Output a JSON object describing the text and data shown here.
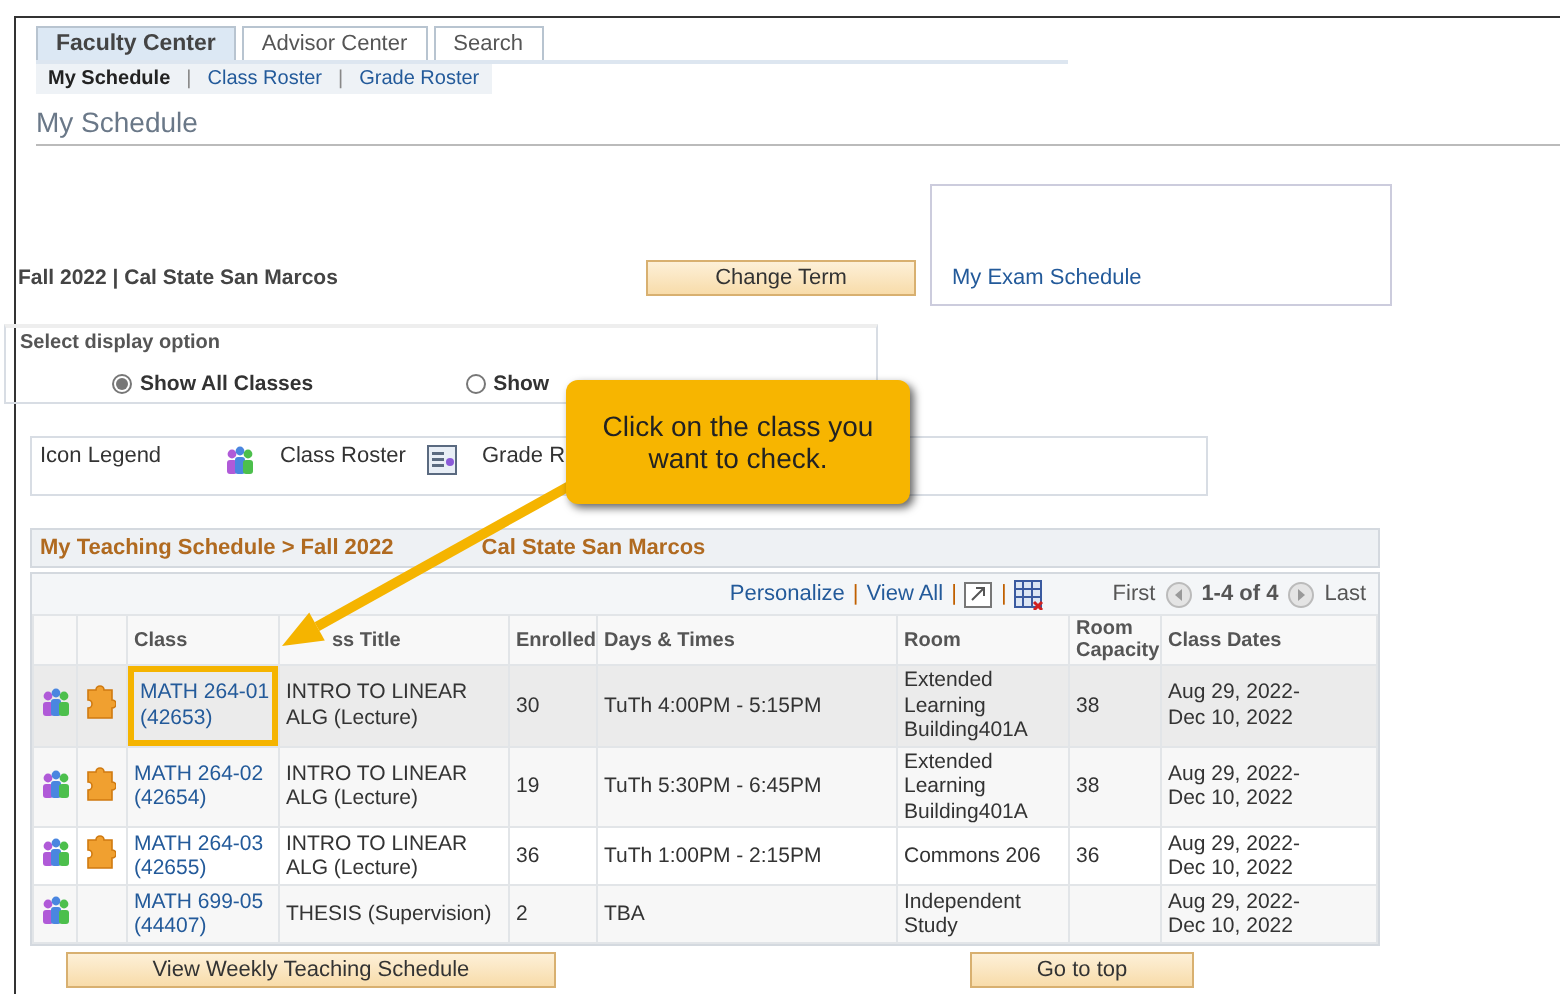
{
  "tabs": [
    {
      "label": "Faculty Center",
      "selected": true
    },
    {
      "label": "Advisor Center",
      "selected": false
    },
    {
      "label": "Search",
      "selected": false
    }
  ],
  "subnav": {
    "items": [
      {
        "label": "My Schedule",
        "selected": true
      },
      {
        "label": "Class Roster",
        "selected": false
      },
      {
        "label": "Grade Roster",
        "selected": false
      }
    ],
    "separators": [
      "|",
      "|"
    ]
  },
  "page_title": "My Schedule",
  "term": "Fall 2022 | Cal State San Marcos",
  "change_term_button": "Change Term",
  "exam_link": "My Exam Schedule",
  "display_option": {
    "title": "Select display option",
    "options": [
      {
        "label": "Show All Classes",
        "selected": true
      },
      {
        "label": "Show",
        "selected": false
      }
    ]
  },
  "legend": {
    "title": "Icon Legend",
    "items": [
      {
        "label": "Class Roster",
        "kind": "roster"
      },
      {
        "label": "Grade R",
        "kind": "grade"
      }
    ]
  },
  "grid": {
    "title_parts": [
      "My Teaching Schedule > Fall 2022",
      "Cal State San Marcos"
    ],
    "toolbar": {
      "links": [
        "Personalize",
        "View All"
      ],
      "separators": [
        "|",
        "|",
        "|"
      ],
      "first": "First",
      "range": "1-4 of 4",
      "last": "Last"
    },
    "columns": [
      "Class",
      "ss Title",
      "Enrolled",
      "Days & Times",
      "Room",
      "Room Capacity",
      "Class Dates"
    ],
    "rows": [
      {
        "selected": true,
        "grade_roster": true,
        "class": "MATH 264-01 (42653)",
        "title": "INTRO TO LINEAR ALG (Lecture)",
        "enrolled": "30",
        "days_times": "TuTh 4:00PM - 5:15PM",
        "room": "Extended Learning Building401A",
        "capacity": "38",
        "dates": "Aug 29, 2022- Dec 10, 2022"
      },
      {
        "selected": false,
        "grade_roster": true,
        "class": "MATH 264-02 (42654)",
        "title": "INTRO TO LINEAR ALG (Lecture)",
        "enrolled": "19",
        "days_times": "TuTh 5:30PM - 6:45PM",
        "room": "Extended Learning Building401A",
        "capacity": "38",
        "dates": "Aug 29, 2022- Dec 10, 2022"
      },
      {
        "selected": false,
        "grade_roster": true,
        "class": "MATH 264-03 (42655)",
        "title": "INTRO TO LINEAR ALG (Lecture)",
        "enrolled": "36",
        "days_times": "TuTh 1:00PM - 2:15PM",
        "room": "Commons 206",
        "capacity": "36",
        "dates": "Aug 29, 2022- Dec 10, 2022"
      },
      {
        "selected": false,
        "grade_roster": false,
        "class": "MATH 699-05 (44407)",
        "title": "THESIS (Supervision)",
        "enrolled": "2",
        "days_times": "TBA",
        "room": "Independent Study",
        "capacity": "",
        "dates": "Aug 29, 2022- Dec 10, 2022"
      }
    ]
  },
  "bottom_buttons": [
    "View Weekly Teaching Schedule",
    "Go to top"
  ],
  "callout": "Click on the class you want to check."
}
